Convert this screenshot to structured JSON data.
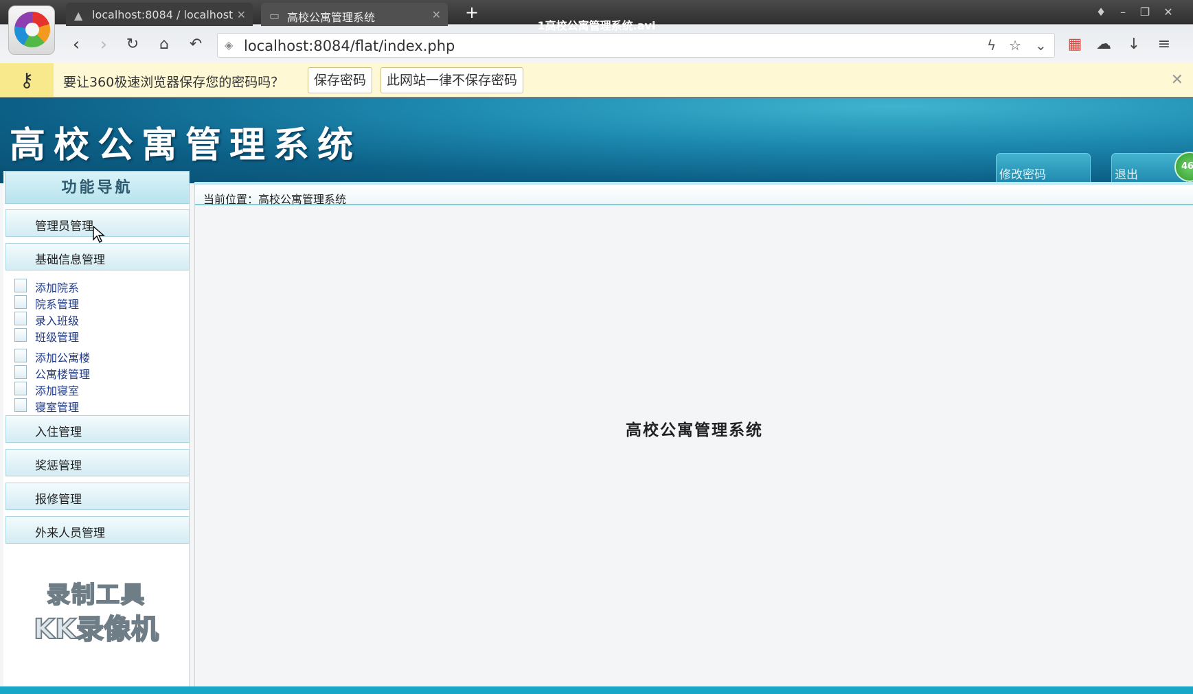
{
  "browser": {
    "tabs": [
      {
        "label": "localhost:8084 / localhost",
        "icon": "server-icon"
      },
      {
        "label": "高校公寓管理系统",
        "icon": "page-icon"
      }
    ],
    "video_title": "1高校公寓管理系统.avi",
    "url": "localhost:8084/flat/index.php"
  },
  "password_bar": {
    "message": "要让360极速浏览器保存您的密码吗？",
    "save_button": "保存密码",
    "never_button": "此网站一律不保存密码"
  },
  "header": {
    "system_name": "高校公寓管理系统",
    "change_password": "修改密码",
    "logout": "退出",
    "badge": "46"
  },
  "sidebar": {
    "title": "功能导航",
    "menus": {
      "admin": "管理员管理",
      "basic": "基础信息管理",
      "checkin": "入住管理",
      "rewards": "奖惩管理",
      "repair": "报修管理",
      "visitor": "外来人员管理"
    },
    "sub_items": [
      "添加院系",
      "院系管理",
      "录入班级",
      "班级管理",
      "添加公寓楼",
      "公寓楼管理",
      "添加寝室",
      "寝室管理"
    ]
  },
  "content": {
    "breadcrumb": "当前位置：高校公寓管理系统",
    "welcome": "高校公寓管理系统"
  },
  "watermark": {
    "line1": "录制工具",
    "line2": "KK录像机"
  }
}
